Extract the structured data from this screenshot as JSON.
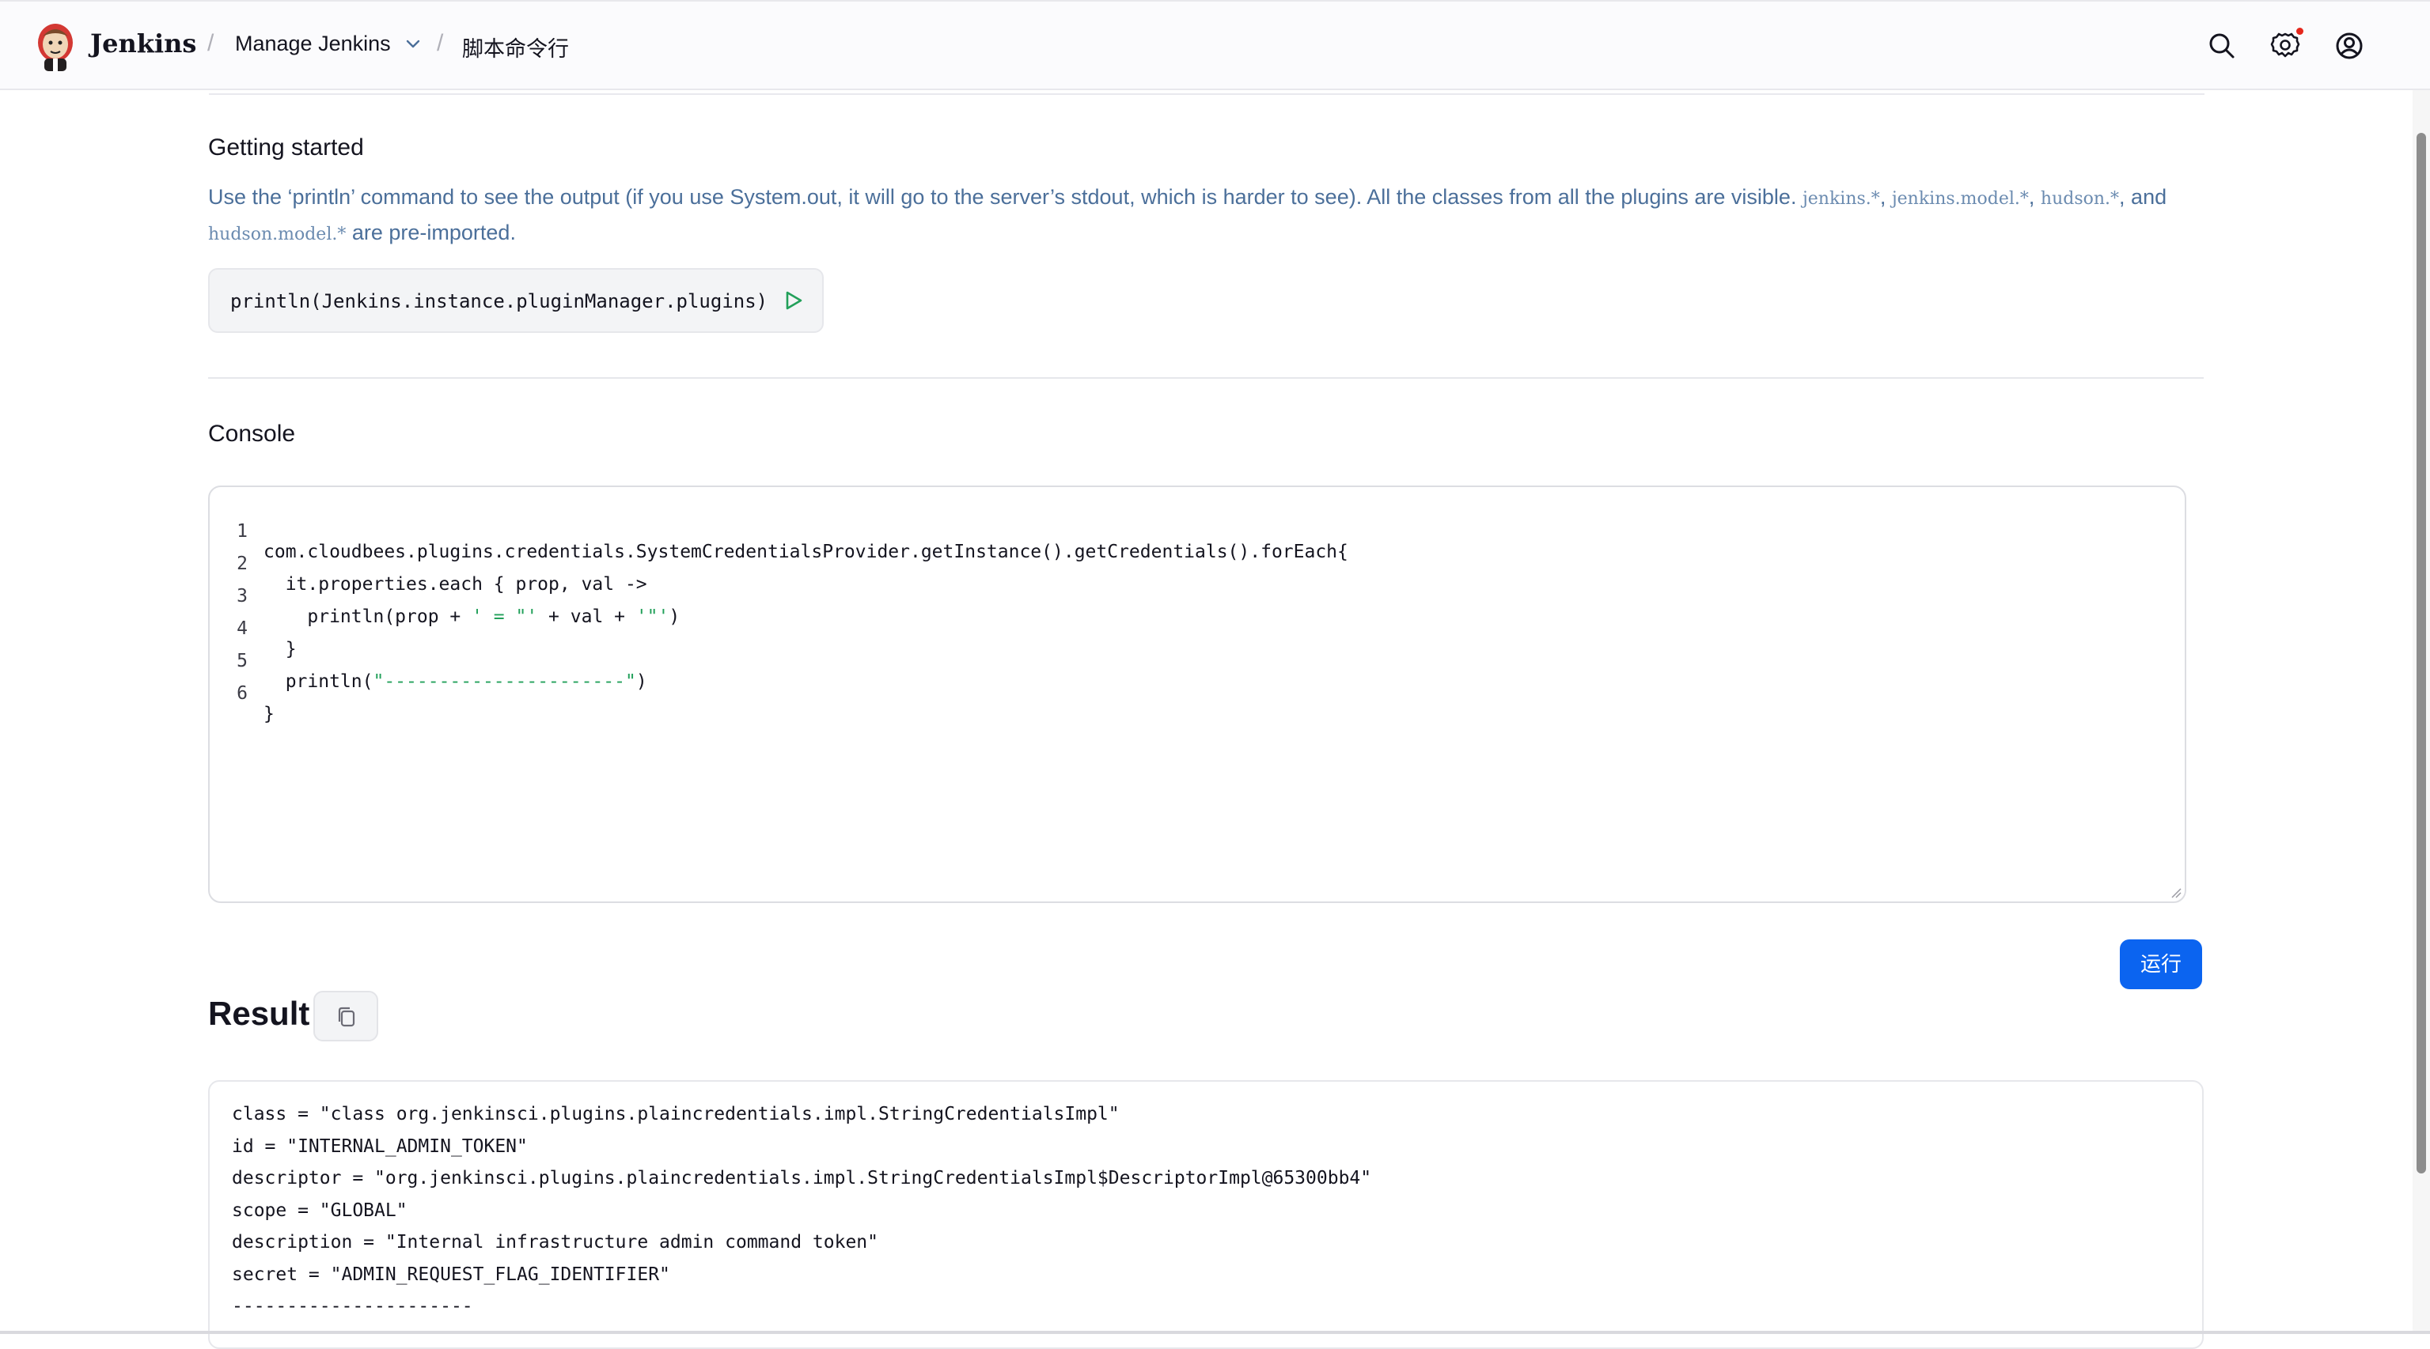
{
  "header": {
    "brand": "Jenkins",
    "breadcrumbs": [
      "Manage Jenkins",
      "脚本命令行"
    ],
    "separator": "/",
    "icons": [
      "search-icon",
      "gear-icon",
      "user-icon"
    ],
    "notification_color": "#e5271c"
  },
  "getting_started": {
    "title": "Getting started",
    "desc_parts": [
      "Use the ‘println’ command to see the output (if you use System.out, it will go to the server’s stdout, which is harder to see). All the classes from all the plugins are visible. ",
      "jenkins.*",
      ", ",
      "jenkins.model.*",
      ", ",
      "hudson.*",
      ", and ",
      "hudson.model.*",
      " are pre-imported."
    ],
    "snippet": "println(Jenkins.instance.pluginManager.plugins)"
  },
  "console": {
    "title": "Console",
    "lines": [
      {
        "n": "1",
        "a": "com.cloudbees.plugins.credentials.SystemCredentialsProvider.getInstance().getCredentials().forEach{",
        "s1": "",
        "b": "",
        "s2": "",
        "c": ""
      },
      {
        "n": "2",
        "a": "  it.properties.each { prop, val ->",
        "s1": "",
        "b": "",
        "s2": "",
        "c": ""
      },
      {
        "n": "3",
        "a": "    println(prop + ",
        "s1": "' = \"'",
        "b": " + val + ",
        "s2": "'\"'",
        "c": ")"
      },
      {
        "n": "4",
        "a": "  }",
        "s1": "",
        "b": "",
        "s2": "",
        "c": ""
      },
      {
        "n": "5",
        "a": "  println(",
        "s1": "\"----------------------\"",
        "b": ")",
        "s2": "",
        "c": ""
      },
      {
        "n": "6",
        "a": "}",
        "s1": "",
        "b": "",
        "s2": "",
        "c": ""
      }
    ],
    "string_color": "#22a05a"
  },
  "run_label": "运行",
  "result": {
    "title": "Result",
    "lines": [
      "class = \"class org.jenkinsci.plugins.plaincredentials.impl.StringCredentialsImpl\"",
      "id = \"INTERNAL_ADMIN_TOKEN\"",
      "descriptor = \"org.jenkinsci.plugins.plaincredentials.impl.StringCredentialsImpl$DescriptorImpl@65300bb4\"",
      "scope = \"GLOBAL\"",
      "description = \"Internal infrastructure admin command token\"",
      "secret = \"ADMIN_REQUEST_FLAG_IDENTIFIER\"",
      "----------------------"
    ]
  },
  "colors": {
    "accent": "#0b64f0",
    "link_text": "#4b6f9a"
  }
}
